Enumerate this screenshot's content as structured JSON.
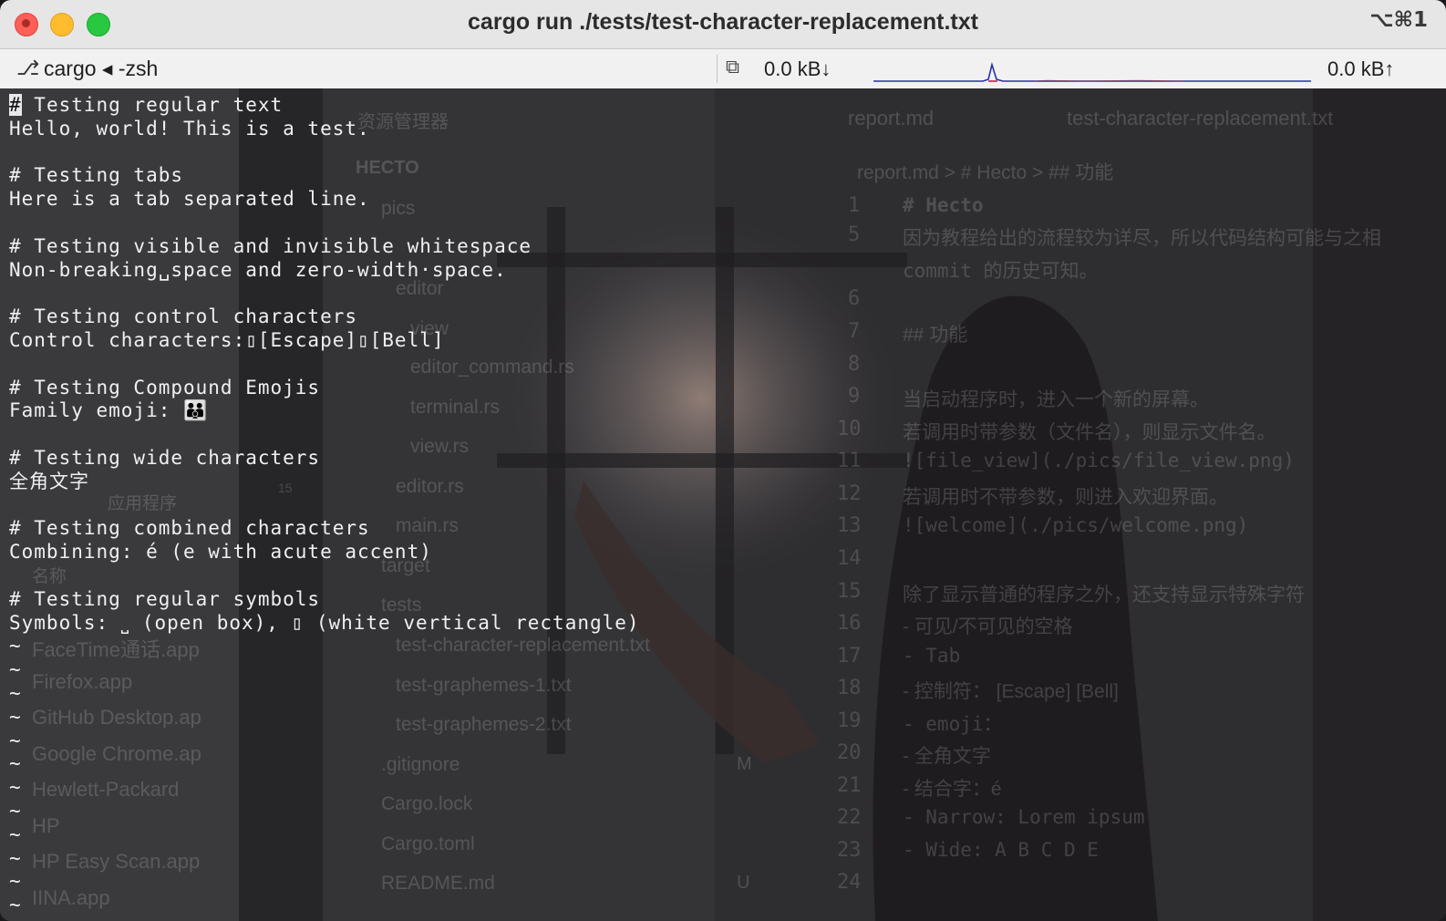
{
  "window": {
    "title": "cargo run ./tests/test-character-replacement.txt",
    "shortcut": "⌥⌘1"
  },
  "tabbar": {
    "tab_label": "cargo ◂ -zsh",
    "net_down": "0.0 kB↓",
    "net_up": "0.0 kB↑"
  },
  "terminal": {
    "lines": [
      "# Testing regular text",
      "Hello, world! This is a test.",
      "",
      "# Testing tabs",
      "Here is a tab separated line.",
      "",
      "# Testing visible and invisible whitespace",
      "Non-breaking␣space and zero-width·space.",
      "",
      "# Testing control characters",
      "Control characters:▯[Escape]▯[Bell]",
      "",
      "# Testing Compound Emojis",
      "Family emoji: 👪",
      "",
      "# Testing wide characters",
      "全角文字",
      "",
      "# Testing combined characters",
      "Combining: é (e with acute accent)",
      "",
      "# Testing regular symbols",
      "Symbols: ⎵ (open box), ▯ (white vertical rectangle)",
      "~",
      "~",
      "~",
      "~",
      "~",
      "~",
      "~",
      "~",
      "~",
      "~",
      "~",
      "~"
    ]
  },
  "background": {
    "sidebar_header": "资源管理器",
    "project": "HECTO",
    "tree": [
      "pics",
      "editor",
      "view",
      "editor_command.rs",
      "terminal.rs",
      "view.rs",
      "editor.rs",
      "main.rs",
      "target",
      "tests",
      "test-character-replacement.txt",
      "test-graphemes-1.txt",
      "test-graphemes-2.txt",
      ".gitignore",
      "Cargo.lock",
      "Cargo.toml",
      "README.md"
    ],
    "badge": "15",
    "badge_m": "M",
    "badge_u": "U",
    "apps": [
      "FaceTime通话.app",
      "Firefox.app",
      "GitHub Desktop.ap",
      "Google Chrome.ap",
      "Hewlett-Packard",
      "HP",
      "HP Easy Scan.app",
      "IINA.app"
    ],
    "left_labels": [
      "名称",
      "应用程序"
    ],
    "editor_tab_1": "report.md",
    "editor_tab_2": "test-character-replacement.txt",
    "breadcrumb": "report.md > # Hecto > ## 功能",
    "line_numbers": [
      "1",
      "5",
      "",
      "6",
      "7",
      "8",
      "9",
      "10",
      "11",
      "12",
      "13",
      "14",
      "15",
      "16",
      "17",
      "18",
      "19",
      "20",
      "21",
      "22",
      "23",
      "24"
    ],
    "code_lines": [
      "# Hecto",
      "因为教程给出的流程较为详尽，所以代码结构可能与之相",
      "commit 的历史可知。",
      "",
      "## 功能",
      "",
      "当启动程序时，进入一个新的屏幕。",
      "若调用时带参数（文件名），则显示文件名。",
      "![file_view](./pics/file_view.png)",
      "若调用时不带参数，则进入欢迎界面。",
      "![welcome](./pics/welcome.png)",
      "",
      "除了显示普通的程序之外，还支持显示特殊字符",
      "- 可见/不可见的空格",
      "- Tab",
      "- 控制符： [Escape] [Bell]",
      "- emoji：",
      "- 全角文字",
      "- 结合字：é",
      "- Narrow: Lorem ipsum",
      "- Wide: A B C D E"
    ]
  },
  "colors": {
    "close": "#fe5f57",
    "minimize": "#febc2e",
    "maximize": "#28c840",
    "graph_line": "#2233aa",
    "graph_spike": "#cc2222"
  }
}
